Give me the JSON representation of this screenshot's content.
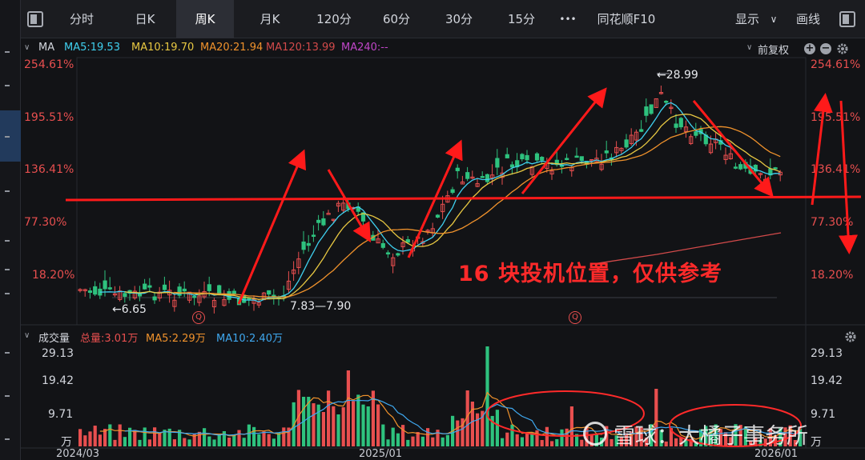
{
  "toolbar": {
    "items": [
      "分时",
      "日K",
      "周K",
      "月K",
      "120分",
      "60分",
      "30分",
      "15分"
    ],
    "active": "周K",
    "more": "•••",
    "f10": "同花顺F10",
    "display": "显示",
    "draw": "画线"
  },
  "ma_header": {
    "label": "MA",
    "ma5": "MA5:19.53",
    "ma10": "MA10:19.70",
    "ma20": "MA20:21.94",
    "ma120": "MA120:13.99",
    "ma240": "MA240:--",
    "adjust": "前复权",
    "colors": {
      "ma5": "#3fd0ef",
      "ma10": "#e8c842",
      "ma20": "#f0922c",
      "ma120": "#d24a4a",
      "ma240": "#c046c8"
    }
  },
  "price_axis": [
    "254.61%",
    "195.51%",
    "136.41%",
    "77.30%",
    "18.20%"
  ],
  "price_axis_right": [
    "254.61%",
    "195.51%",
    "136.41%",
    "77.30%",
    "18.20%"
  ],
  "annotations": {
    "high": "28.99",
    "low": "6.65",
    "range": "7.83—7.90",
    "q_mark": "Q"
  },
  "overlay_text": "16 块投机位置，仅供参考",
  "volume_header": {
    "label": "成交量",
    "total": "总量:3.01万",
    "ma5": "MA5:2.29万",
    "ma10": "MA10:2.40万"
  },
  "volume_axis": [
    "29.13",
    "19.42",
    "9.71",
    "万"
  ],
  "volume_axis_right": [
    "29.13",
    "19.42",
    "9.71",
    "万"
  ],
  "dates": [
    "2024/03",
    "2025/01",
    "2026/01"
  ],
  "watermark": "雪球：大橘子事务所",
  "colors": {
    "up": "#e84f4f",
    "down": "#2ec27e",
    "accent": "#ff1a1a"
  }
}
